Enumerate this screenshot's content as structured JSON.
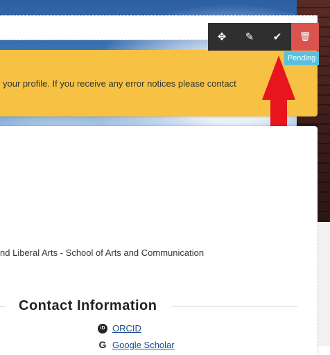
{
  "toolbar": {
    "buttons": [
      {
        "name": "move",
        "glyph": "✥"
      },
      {
        "name": "edit",
        "glyph": "✎"
      },
      {
        "name": "approve",
        "glyph": "✔"
      },
      {
        "name": "delete",
        "glyph": "🗑"
      }
    ],
    "status": "Pending"
  },
  "alert": {
    "text": "your profile. If you receive any error notices please contact"
  },
  "profile": {
    "department": "nd Liberal Arts - School of Arts and Communication"
  },
  "contact": {
    "title": "Contact Information",
    "links": [
      {
        "label": "ORCID",
        "icon": "orcid-icon"
      },
      {
        "label": "Google Scholar",
        "icon": "google-icon"
      }
    ]
  },
  "colors": {
    "alert_bg": "#f7c244",
    "delete_bg": "#d9534f",
    "pending_bg": "#5bc0de",
    "arrow": "#e8141e"
  }
}
